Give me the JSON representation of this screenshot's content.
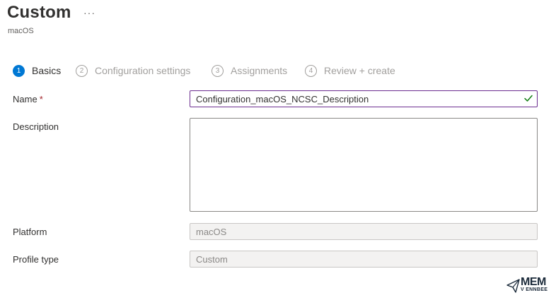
{
  "header": {
    "title": "Custom",
    "more_label": "···",
    "subtitle": "macOS"
  },
  "steps": [
    {
      "number": "1",
      "label": "Basics",
      "active": true
    },
    {
      "number": "2",
      "label": "Configuration settings",
      "active": false
    },
    {
      "number": "3",
      "label": "Assignments",
      "active": false
    },
    {
      "number": "4",
      "label": "Review + create",
      "active": false
    }
  ],
  "form": {
    "name_label": "Name",
    "required_marker": "*",
    "name_value": "Configuration_macOS_NCSC_Description",
    "description_label": "Description",
    "description_value": "",
    "platform_label": "Platform",
    "platform_value": "macOS",
    "profile_type_label": "Profile type",
    "profile_type_value": "Custom"
  },
  "logo": {
    "line1": "MEM",
    "line2": "V ENNBEE"
  },
  "colors": {
    "accent": "#0078d4",
    "focus_border": "#6b2d8f",
    "required": "#a4262c",
    "check": "#107c10"
  }
}
